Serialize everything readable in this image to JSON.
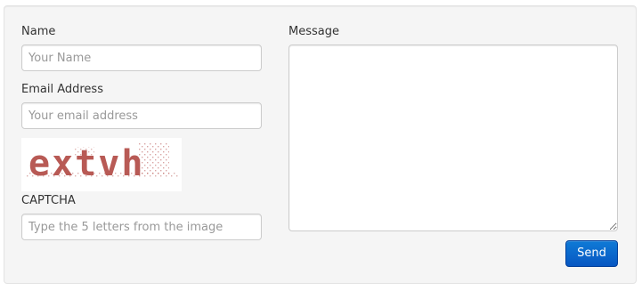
{
  "form": {
    "name": {
      "label": "Name",
      "placeholder": "Your Name",
      "value": ""
    },
    "email": {
      "label": "Email Address",
      "placeholder": "Your email address",
      "value": ""
    },
    "captcha": {
      "image_text": "extvh",
      "image_color": "#b85a55",
      "label": "CAPTCHA",
      "placeholder": "Type the 5 letters from the image",
      "value": ""
    },
    "message": {
      "label": "Message",
      "value": ""
    },
    "send_label": "Send"
  },
  "colors": {
    "panel_background": "#f5f5f5",
    "button_primary": "#0a66c8"
  }
}
